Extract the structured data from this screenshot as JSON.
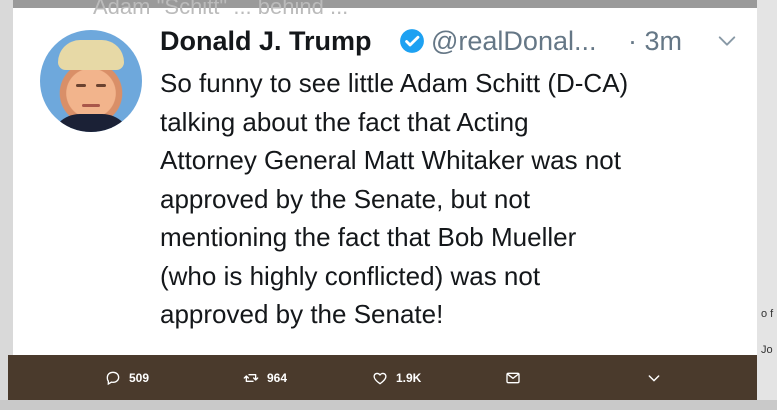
{
  "background": {
    "ghost_text": "Adam \"Schitt\" ... behind ...",
    "right_fragments": [
      "o f",
      "Jo"
    ]
  },
  "tweet": {
    "author_name": "Donald J. Trump",
    "handle": "@realDonal...",
    "time": "· 3m",
    "verified": true,
    "text_lines": [
      "So funny to see little Adam Schitt (D-CA)",
      "talking about the fact that Acting",
      "Attorney General Matt Whitaker was not",
      "approved by the Senate, but not",
      "mentioning the fact that Bob Mueller",
      "(who is highly conflicted) was not",
      "approved by the Senate!"
    ]
  },
  "actions": {
    "replies": "509",
    "retweets": "964",
    "likes": "1.9K",
    "icons": [
      "reply-icon",
      "retweet-icon",
      "like-icon",
      "direct-message-icon",
      "chevron-down-icon"
    ]
  },
  "colors": {
    "verified": "#1da1f2",
    "name": "#14171a",
    "secondary": "#657786",
    "action_bar": "#4a3a2c"
  }
}
